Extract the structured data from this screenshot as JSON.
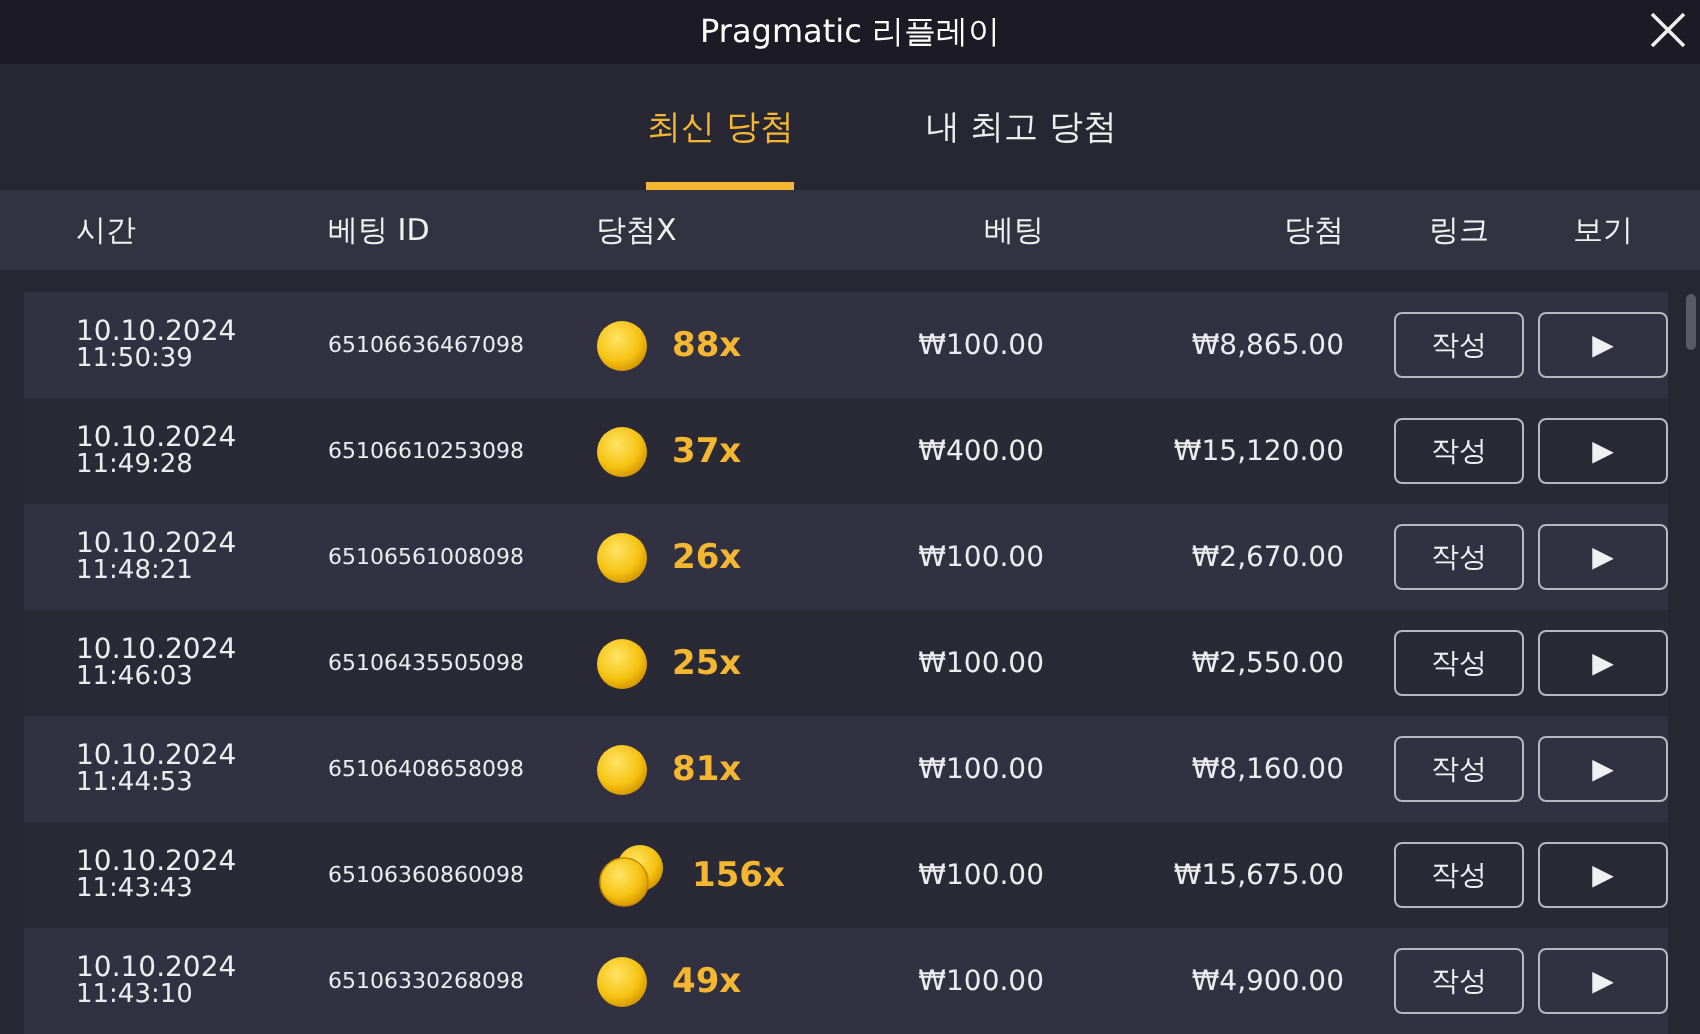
{
  "window": {
    "title": "Pragmatic 리플레이"
  },
  "tabs": [
    {
      "label": "최신 당첨",
      "selected": true
    },
    {
      "label": "내 최고 당첨",
      "selected": false
    }
  ],
  "table": {
    "columns": [
      "시간",
      "베팅 ID",
      "당첨X",
      "베팅",
      "당첨",
      "링크",
      "보기"
    ],
    "rows": [
      {
        "date": "10.10.2024",
        "time": "11:50:39",
        "bet_id": "65106636467098",
        "kind": "single",
        "multiplier": "88x",
        "bet": "₩100.00",
        "win": "₩8,865.00",
        "link": "작성",
        "view": "▶"
      },
      {
        "date": "10.10.2024",
        "time": "11:49:28",
        "bet_id": "65106610253098",
        "kind": "single",
        "multiplier": "37x",
        "bet": "₩400.00",
        "win": "₩15,120.00",
        "link": "작성",
        "view": "▶"
      },
      {
        "date": "10.10.2024",
        "time": "11:48:21",
        "bet_id": "65106561008098",
        "kind": "single",
        "multiplier": "26x",
        "bet": "₩100.00",
        "win": "₩2,670.00",
        "link": "작성",
        "view": "▶"
      },
      {
        "date": "10.10.2024",
        "time": "11:46:03",
        "bet_id": "65106435505098",
        "kind": "single",
        "multiplier": "25x",
        "bet": "₩100.00",
        "win": "₩2,550.00",
        "link": "작성",
        "view": "▶"
      },
      {
        "date": "10.10.2024",
        "time": "11:44:53",
        "bet_id": "65106408658098",
        "kind": "single",
        "multiplier": "81x",
        "bet": "₩100.00",
        "win": "₩8,160.00",
        "link": "작성",
        "view": "▶"
      },
      {
        "date": "10.10.2024",
        "time": "11:43:43",
        "bet_id": "65106360860098",
        "kind": "double",
        "multiplier": "156x",
        "bet": "₩100.00",
        "win": "₩15,675.00",
        "link": "작성",
        "view": "▶"
      },
      {
        "date": "10.10.2024",
        "time": "11:43:10",
        "bet_id": "65106330268098",
        "kind": "single",
        "multiplier": "49x",
        "bet": "₩100.00",
        "win": "₩4,900.00",
        "link": "작성",
        "view": "▶"
      }
    ]
  }
}
